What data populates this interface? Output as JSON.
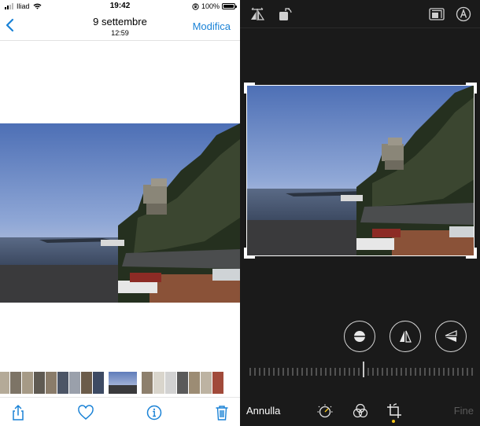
{
  "left": {
    "status": {
      "carrier": "Iliad",
      "time": "19:42",
      "battery": "100%"
    },
    "nav": {
      "back_icon": "chevron-left-icon",
      "title": "9 settembre",
      "subtitle": "12:59",
      "edit_label": "Modifica"
    },
    "toolbar": {
      "icons": [
        "share-icon",
        "heart-icon",
        "info-icon",
        "trash-icon"
      ]
    }
  },
  "right": {
    "top_icons": [
      "flip-icon",
      "rotate-icon",
      "aspect-ratio-icon",
      "auto-crop-icon"
    ],
    "adjust_buttons": [
      "straighten-icon",
      "vertical-perspective-icon",
      "horizontal-perspective-icon"
    ],
    "bottom": {
      "cancel_label": "Annulla",
      "done_label": "Fine",
      "tool_icons": [
        "adjust-icon",
        "filters-icon",
        "crop-rotate-icon"
      ]
    }
  },
  "colors": {
    "accent": "#1a82d6",
    "dark_bg": "#1a1a1a",
    "indicator": "#f5c518"
  }
}
